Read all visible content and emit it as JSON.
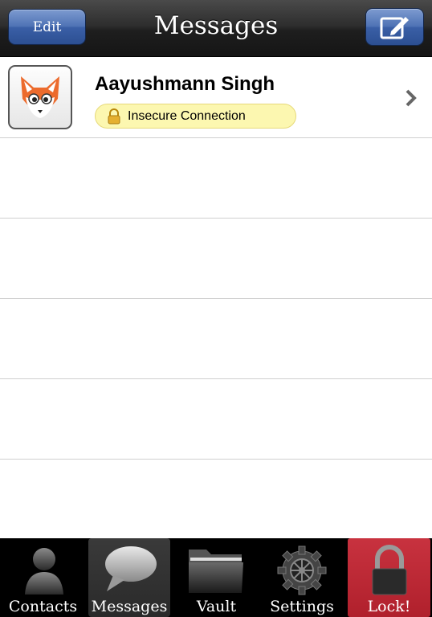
{
  "navbar": {
    "title": "Messages",
    "edit_label": "Edit",
    "compose_icon": "compose-icon"
  },
  "conversations": [
    {
      "name": "Aayushmann Singh",
      "status": "Insecure Connection",
      "avatar_icon": "fox-avatar-icon",
      "status_icon": "lock-icon"
    }
  ],
  "tabs": [
    {
      "label": "Contacts",
      "icon": "person-icon"
    },
    {
      "label": "Messages",
      "icon": "speech-bubble-icon",
      "selected": true
    },
    {
      "label": "Vault",
      "icon": "folder-icon"
    },
    {
      "label": "Settings",
      "icon": "gear-icon"
    },
    {
      "label": "Lock!",
      "icon": "padlock-icon"
    }
  ],
  "colors": {
    "nav_button": "#4f73b5",
    "status_badge": "#fcf7b0",
    "lock_tab": "#c8323f"
  }
}
